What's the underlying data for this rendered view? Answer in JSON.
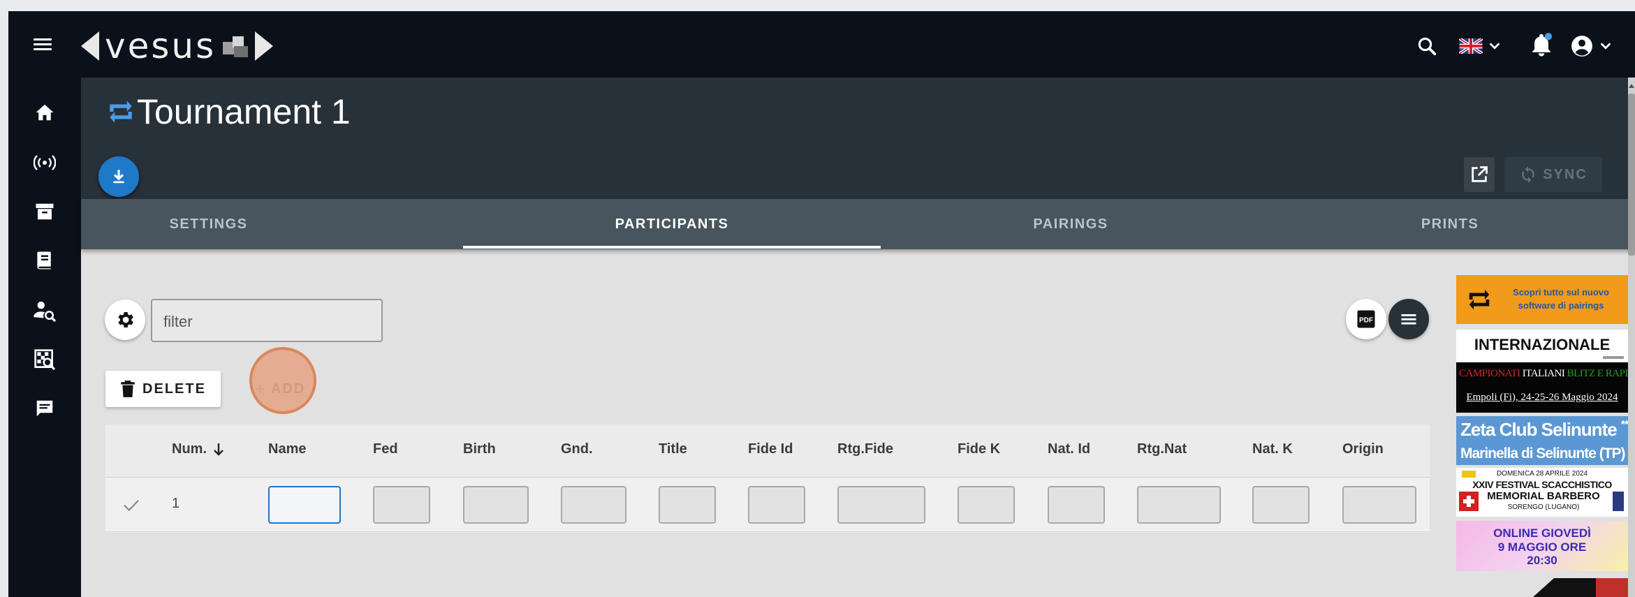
{
  "app": {
    "logo_text": "vesus"
  },
  "header": {
    "language": "en",
    "notification_badge": true
  },
  "sidebar": {
    "items": [
      {
        "icon": "home-icon"
      },
      {
        "icon": "live-broadcast-icon"
      },
      {
        "icon": "archive-icon"
      },
      {
        "icon": "book-icon"
      },
      {
        "icon": "player-search-icon"
      },
      {
        "icon": "board-search-icon"
      },
      {
        "icon": "chat-icon"
      }
    ]
  },
  "tournament": {
    "title": "Tournament 1",
    "sync_label": "SYNC"
  },
  "tabs": [
    {
      "label": "SETTINGS"
    },
    {
      "label": "PARTICIPANTS"
    },
    {
      "label": "PAIRINGS"
    },
    {
      "label": "PRINTS"
    }
  ],
  "active_tab": "PARTICIPANTS",
  "toolbar": {
    "filter_value": "filter",
    "delete_label": "DELETE",
    "add_label": "ADD",
    "pdf_label": "PDF"
  },
  "table": {
    "columns": [
      "Num.",
      "Name",
      "Fed",
      "Birth",
      "Gnd.",
      "Title",
      "Fide Id",
      "Rtg.Fide",
      "Fide K",
      "Nat. Id",
      "Rtg.Nat",
      "Nat. K",
      "Origin"
    ],
    "sort_column": "Num.",
    "sort_direction": "descending",
    "rows": [
      {
        "num": "1",
        "name": "",
        "fed": "",
        "birth": "",
        "gnd": "",
        "title": "",
        "fide_id": "",
        "rtg_fide": "",
        "fide_k": "",
        "nat_id": "",
        "rtg_nat": "",
        "nat_k": "",
        "origin": ""
      }
    ]
  },
  "banners": [
    {
      "line1": "Scopri tutto sul nuovo",
      "line2": "software di pairings"
    },
    {
      "text": "INTERNAZIONALE"
    },
    {
      "line1_a": "CAMPIONATI",
      "line1_b": "ITALIANI",
      "line1_c": "BLITZ E RAPID",
      "line2": "Empoli (Fi), 24-25-26 Maggio 2024"
    },
    {
      "line1": "Zeta Club Selinunte",
      "stars": "****",
      "line2": "Marinella di Selinunte (TP)"
    },
    {
      "line1": "DOMENICA 28 APRILE 2024",
      "line2": "XXIV FESTIVAL SCACCHISTICO",
      "line3": "MEMORIAL BARBERO",
      "line4": "SORENGO (LUGANO)"
    },
    {
      "line1": "ONLINE GIOVEDÌ",
      "line2": "9 MAGGIO ORE",
      "line3": "20:30"
    }
  ],
  "colors": {
    "navbar": "#0a111a",
    "header": "#273139",
    "tabs": "#48555e",
    "accent": "#1e79c8"
  }
}
